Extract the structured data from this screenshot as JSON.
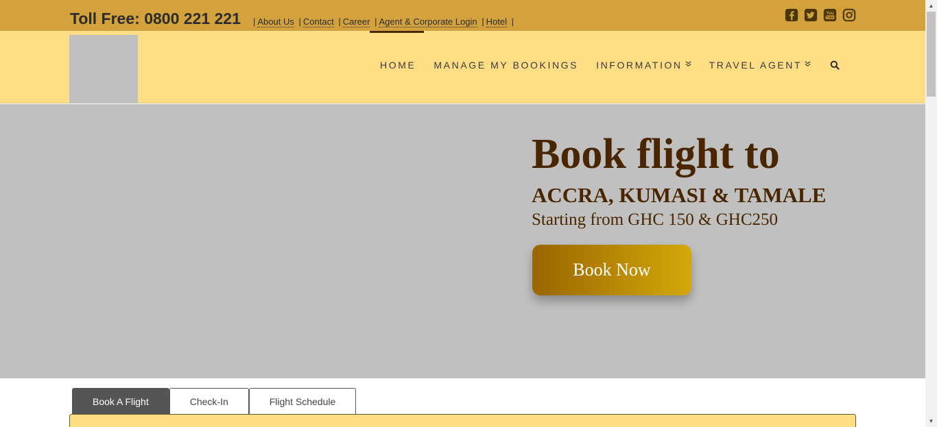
{
  "topbar": {
    "toll_free": "Toll Free: 0800 221 221",
    "links": [
      "About Us",
      "Contact",
      "Career",
      "Agent & Corporate Login",
      "Hotel"
    ],
    "separator": "|",
    "social_icons": [
      "facebook-icon",
      "twitter-icon",
      "youtube-icon",
      "instagram-icon"
    ]
  },
  "nav": {
    "items": [
      "HOME",
      "MANAGE MY BOOKINGS",
      "INFORMATION",
      "TRAVEL AGENT"
    ],
    "dropdown_glyph": "»"
  },
  "hero": {
    "title": "Book flight to",
    "destinations": "ACCRA, KUMASI & TAMALE",
    "price_text": "Starting from GHC 150 & GHC250",
    "button_label": "Book Now"
  },
  "tabs": [
    "Book A Flight",
    "Check-In",
    "Flight Schedule"
  ],
  "colors": {
    "topbar": "#d4a23d",
    "header": "#fedd84",
    "hero_text": "#4a2600",
    "active_tab": "#555555"
  }
}
